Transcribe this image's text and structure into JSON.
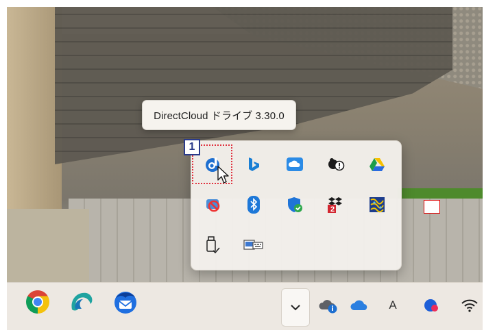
{
  "tooltip": {
    "text": "DirectCloud ドライブ 3.30.0"
  },
  "annotation": {
    "step_number": "1"
  },
  "overflow_flyout": {
    "icons": [
      {
        "name": "directcloud-icon",
        "label": ""
      },
      {
        "name": "bing-icon",
        "label": ""
      },
      {
        "name": "onedrive-white-cloud-icon",
        "label": ""
      },
      {
        "name": "app-status-warning-icon",
        "label": ""
      },
      {
        "name": "google-drive-icon",
        "label": ""
      },
      {
        "name": "disabled-app-icon",
        "label": ""
      },
      {
        "name": "bluetooth-icon",
        "label": ""
      },
      {
        "name": "windows-security-icon",
        "label": ""
      },
      {
        "name": "dropbox-sync-icon",
        "label": "2"
      },
      {
        "name": "color-pattern-app-icon",
        "label": ""
      },
      {
        "name": "usb-eject-icon",
        "label": ""
      },
      {
        "name": "keyboard-display-icon",
        "label": ""
      }
    ]
  },
  "taskbar": {
    "apps": [
      "chrome-icon",
      "edge-dev-icon",
      "thunderbird-icon"
    ],
    "tray": [
      "show-hidden-icons-chevron-icon",
      "info-cloud-icon",
      "onedrive-icon",
      "ime-icon",
      "copilot-icon",
      "wifi-icon"
    ],
    "ime_label": "A"
  },
  "colors": {
    "accent_red": "#e0313e",
    "badge_blue": "#2a3a8a",
    "directcloud_blue": "#1e6fd0"
  }
}
